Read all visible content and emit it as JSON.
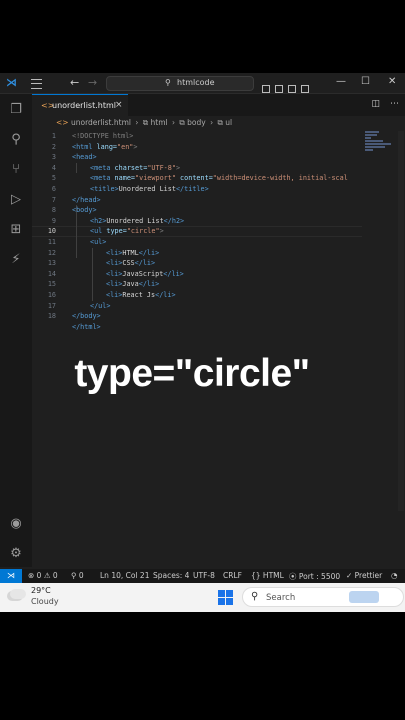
{
  "titlebar": {
    "search_text": "htmlcode",
    "back_icon": "arrow-left-icon",
    "forward_icon": "arrow-right-icon"
  },
  "tab": {
    "label": "unorderlist.html",
    "close": "×"
  },
  "breadcrumb": {
    "file": "unorderlist.html",
    "items": [
      "html",
      "body",
      "ul"
    ]
  },
  "editor": {
    "current_line": 10,
    "lines": [
      {
        "n": "1"
      },
      {
        "n": "2"
      },
      {
        "n": "3"
      },
      {
        "n": "4"
      },
      {
        "n": "5"
      },
      {
        "n": "6"
      },
      {
        "n": "7"
      },
      {
        "n": "8"
      },
      {
        "n": "9"
      },
      {
        "n": "10"
      },
      {
        "n": "11"
      },
      {
        "n": "12"
      },
      {
        "n": "13"
      },
      {
        "n": "14"
      },
      {
        "n": "15"
      },
      {
        "n": "16"
      },
      {
        "n": "17"
      },
      {
        "n": "18"
      }
    ],
    "code": {
      "l1": "<!DOCTYPE html>",
      "l2a": "<html",
      "l2b": " lang=",
      "l2c": "\"en\"",
      "l2d": ">",
      "l3": "<head>",
      "l4a": "<meta",
      "l4b": " charset=",
      "l4c": "\"UTF-8\"",
      "l4d": ">",
      "l5a": "<meta",
      "l5b": " name=",
      "l5c": "\"viewport\"",
      "l5d": " content=",
      "l5e": "\"width=device-width, initial-scal",
      "l6a": "<title>",
      "l6b": "Unordered List",
      "l6c": "</title>",
      "l7": "</head>",
      "l8": "<body>",
      "l9a": "<h2>",
      "l9b": "Unordered List",
      "l9c": "</h2>",
      "l10a": "<ul",
      "l10b": " type=",
      "l10c": "\"circle\"",
      "l10d": ">",
      "l11": "<ul>",
      "l12a": "<li>",
      "l12b": "HTML",
      "l12c": "</li>",
      "l13a": "<li>",
      "l13b": "CSS",
      "l13c": "</li>",
      "l14a": "<li>",
      "l14b": "JavaScript",
      "l14c": "</li>",
      "l15a": "<li>",
      "l15b": "Java",
      "l15c": "</li>",
      "l16a": "<li>",
      "l16b": "React Js",
      "l16c": "</li>",
      "l17": "</ul>",
      "l18": "</body>",
      "l19": "</html>"
    }
  },
  "caption": "type=\"circle\"",
  "statusbar": {
    "errors": "⊗ 0 ⚠ 0",
    "ports": "⚲ 0",
    "position": "Ln 10, Col 21",
    "spaces": "Spaces: 4",
    "encoding": "UTF-8",
    "eol": "CRLF",
    "language": "{} HTML",
    "port": "⦿ Port : 5500",
    "prettier": "✓ Prettier",
    "bell": "🔔"
  },
  "taskbar": {
    "temperature": "29°C",
    "condition": "Cloudy",
    "search_label": "Search"
  },
  "colors": {
    "accent": "#0078d4",
    "tag": "#569cd6",
    "attr": "#9cdcfe",
    "string": "#ce9178"
  }
}
